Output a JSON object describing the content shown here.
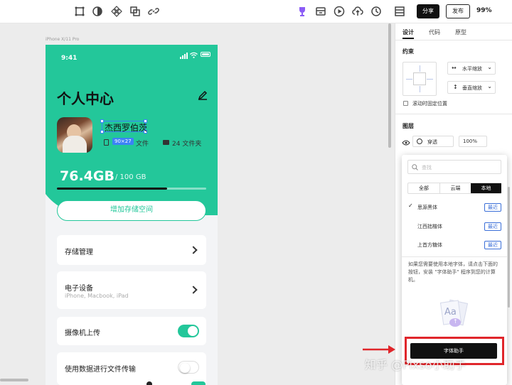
{
  "toolbar": {
    "share_label": "分享",
    "publish_label": "发布",
    "zoom": "99%"
  },
  "canvas": {
    "frame_label": "iPhone X/11 Pro"
  },
  "phone": {
    "status_time": "9:41",
    "title": "个人中心",
    "username": "杰西罗伯茨",
    "selection_size": "90×27",
    "files_label": "文件",
    "folders_value": "24 文件夹",
    "storage_used": "76.4GB",
    "storage_total": "/ 100 GB",
    "storage_fraction": 0.74,
    "add_storage_label": "增加存储空间",
    "rows": {
      "storage": "存储管理",
      "devices_title": "电子设备",
      "devices_sub": "iPhone, Macbook, iPad",
      "camera": "摄像机上传",
      "camera_on": true,
      "data_transfer": "使用数据进行文件传输",
      "data_on": false
    }
  },
  "right_panel": {
    "tabs": [
      "设计",
      "代码",
      "原型"
    ],
    "constraints_title": "约束",
    "h_constraint": "水平缩放",
    "v_constraint": "垂直缩放",
    "fix_scroll_label": "滚动时固定位置",
    "layer_title": "图层",
    "blend_mode": "穿透",
    "opacity": "100%"
  },
  "font_popup": {
    "search_placeholder": "查找",
    "tabs": [
      "全部",
      "云端",
      "本地"
    ],
    "fonts": [
      {
        "name": "思源黑体",
        "badge": "最近",
        "checked": true
      },
      {
        "name": "江西拙楷体",
        "badge": "最近",
        "checked": false
      },
      {
        "name": "上首方糖体",
        "badge": "最近",
        "checked": false
      }
    ],
    "info_text": "如果您需要使用本地字体，请点击下面的按钮，安装 \"字体助手\" 程序到您的计算机。",
    "preview_text": "Aa",
    "helper_button": "字体助手"
  },
  "watermark": "知乎 @Pixso小助手",
  "colors": {
    "accent": "#23c79a",
    "highlight_border": "#e0262b",
    "selection": "#3b82f6"
  }
}
